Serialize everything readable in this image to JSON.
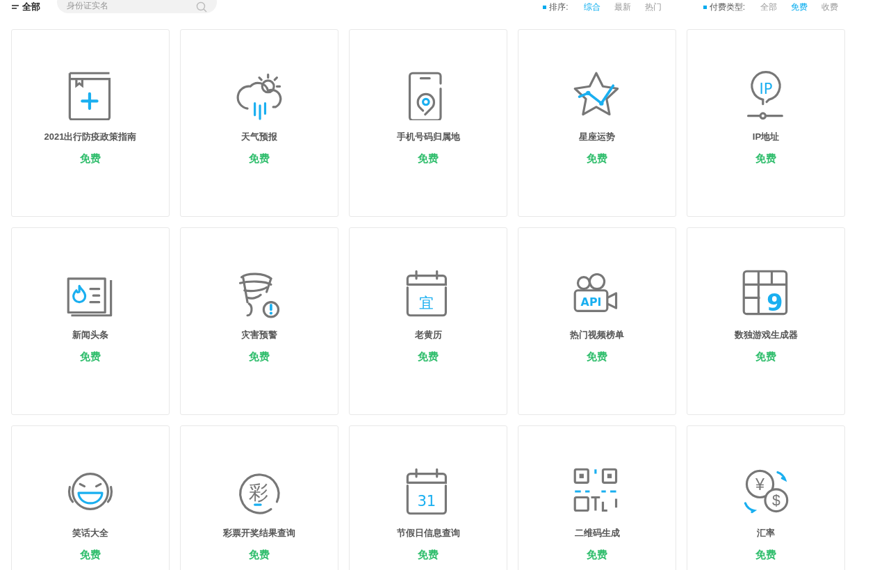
{
  "filter_bar": {
    "category": "全部",
    "search": {
      "placeholder": "身份证实名"
    },
    "sort": {
      "label": "排序:",
      "options": [
        {
          "label": "综合",
          "selected": true
        },
        {
          "label": "最新",
          "selected": false
        },
        {
          "label": "热门",
          "selected": false
        }
      ]
    },
    "pay_type": {
      "label": "付费类型:",
      "options": [
        {
          "label": "全部",
          "selected": false
        },
        {
          "label": "免费",
          "selected": true
        },
        {
          "label": "收费",
          "selected": false
        }
      ]
    }
  },
  "cards": [
    {
      "kind": "book",
      "title": "2021出行防疫政策指南",
      "price": "免费"
    },
    {
      "kind": "weather",
      "title": "天气预报",
      "price": "免费"
    },
    {
      "kind": "phone",
      "title": "手机号码归属地",
      "price": "免费"
    },
    {
      "kind": "star",
      "title": "星座运势",
      "price": "免费"
    },
    {
      "kind": "ip",
      "icon_text": "IP",
      "title": "IP地址",
      "price": "免费"
    },
    {
      "kind": "news",
      "title": "新闻头条",
      "price": "免费"
    },
    {
      "kind": "tornado",
      "title": "灾害预警",
      "price": "免费"
    },
    {
      "kind": "calendar",
      "icon_text": "宜",
      "title": "老黄历",
      "price": "免费"
    },
    {
      "kind": "camera",
      "icon_text": "API",
      "title": "热门视频榜单",
      "price": "免费"
    },
    {
      "kind": "sudoku",
      "icon_text": "9",
      "title": "数独游戏生成器",
      "price": "免费"
    },
    {
      "kind": "laugh",
      "title": "笑话大全",
      "price": "免费"
    },
    {
      "kind": "lottery",
      "icon_text": "彩",
      "title": "彩票开奖结果查询",
      "price": "免费"
    },
    {
      "kind": "calendar",
      "icon_text": "31",
      "title": "节假日信息查询",
      "price": "免费"
    },
    {
      "kind": "qrcode",
      "title": "二维码生成",
      "price": "免费"
    },
    {
      "kind": "exchange",
      "icon_text": "¥",
      "icon_text_2": "$",
      "title": "汇率",
      "price": "免费"
    }
  ]
}
